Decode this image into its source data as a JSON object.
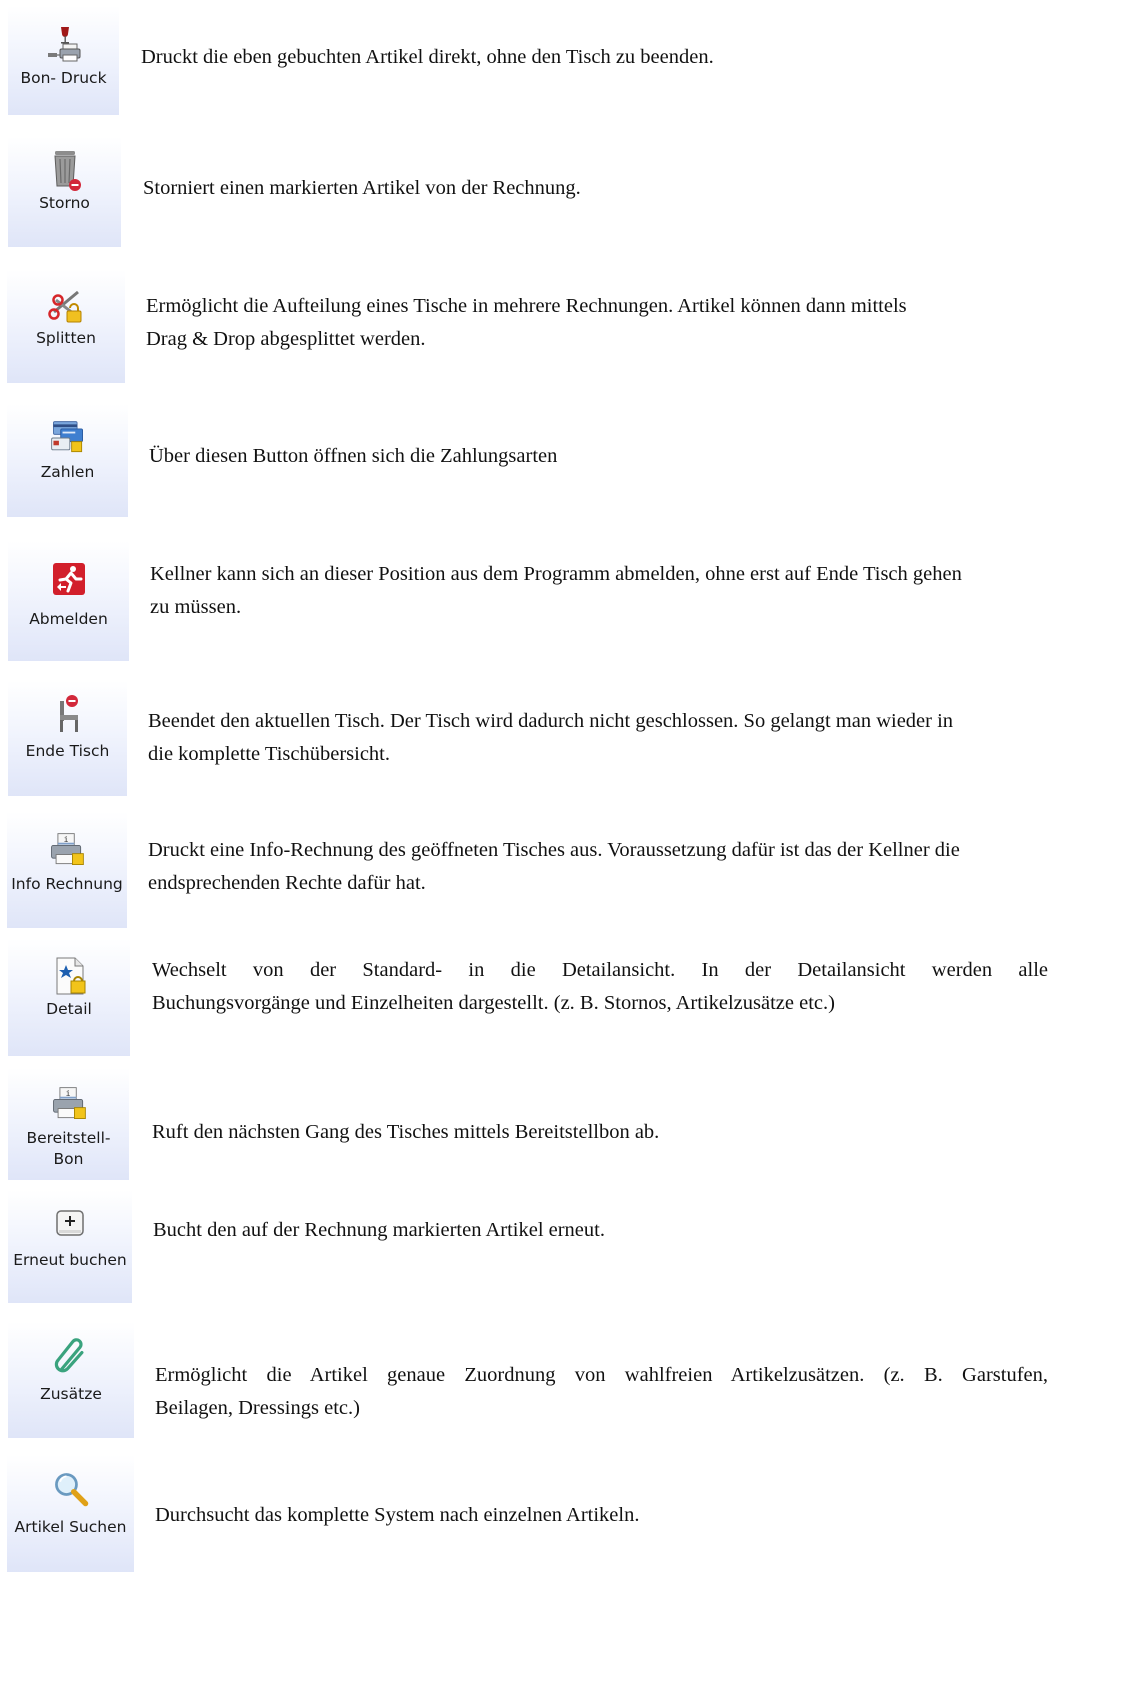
{
  "buttons": [
    {
      "label": "Bon- Druck",
      "icon": "printer-wine-icon",
      "description": "Druckt die eben gebuchten Artikel direkt, ohne den Tisch zu beenden."
    },
    {
      "label": "Storno",
      "icon": "trash-delete-icon",
      "description": "Storniert einen markierten Artikel von der Rechnung."
    },
    {
      "label": "Splitten",
      "icon": "scissors-lock-icon",
      "description_l1": "Ermöglicht die Aufteilung eines Tische in mehrere Rechnungen. Artikel können dann mittels",
      "description_l2": "Drag & Drop abgesplittet werden."
    },
    {
      "label": "Zahlen",
      "icon": "credit-cards-icon",
      "description": "Über diesen Button öffnen sich die Zahlungsarten"
    },
    {
      "label": "Abmelden",
      "icon": "exit-runner-icon",
      "description_l1": "Kellner kann sich an dieser Position aus dem Programm abmelden, ohne erst auf Ende Tisch gehen",
      "description_l2": "zu müssen."
    },
    {
      "label": "Ende Tisch",
      "icon": "chair-stop-icon",
      "description_l1": "Beendet den aktuellen Tisch. Der Tisch wird dadurch nicht geschlossen. So gelangt man wieder in",
      "description_l2": "die komplette Tischübersicht."
    },
    {
      "label": "Info Rechnung",
      "icon": "info-printer-icon",
      "description_l1": "Druckt eine Info-Rechnung des geöffneten Tisches aus. Voraussetzung dafür ist das der Kellner die",
      "description_l2": "endsprechenden Rechte dafür hat."
    },
    {
      "label": "Detail",
      "icon": "document-star-icon",
      "description_l1": "Wechselt von der Standard- in die Detailansicht. In der Detailansicht werden alle",
      "description_l2": "Buchungsvorgänge und Einzelheiten dargestellt. (z. B. Stornos, Artikelzusätze etc.)"
    },
    {
      "label_l1": "Bereitstell-",
      "label_l2": "Bon",
      "icon": "info-printer-icon",
      "description": "Ruft den nächsten Gang des Tisches mittels Bereitstellbon ab."
    },
    {
      "label": "Erneut buchen",
      "icon": "plus-key-icon",
      "description": "Bucht den auf der Rechnung markierten Artikel erneut."
    },
    {
      "label": "Zusätze",
      "icon": "paperclip-icon",
      "description_l1": "Ermöglicht die Artikel genaue Zuordnung von wahlfreien Artikelzusätzen. (z. B. Garstufen,",
      "description_l2": "Beilagen, Dressings etc.)"
    },
    {
      "label": "Artikel Suchen",
      "icon": "magnifier-icon",
      "description": "Durchsucht das komplette System nach einzelnen Artikeln."
    }
  ]
}
